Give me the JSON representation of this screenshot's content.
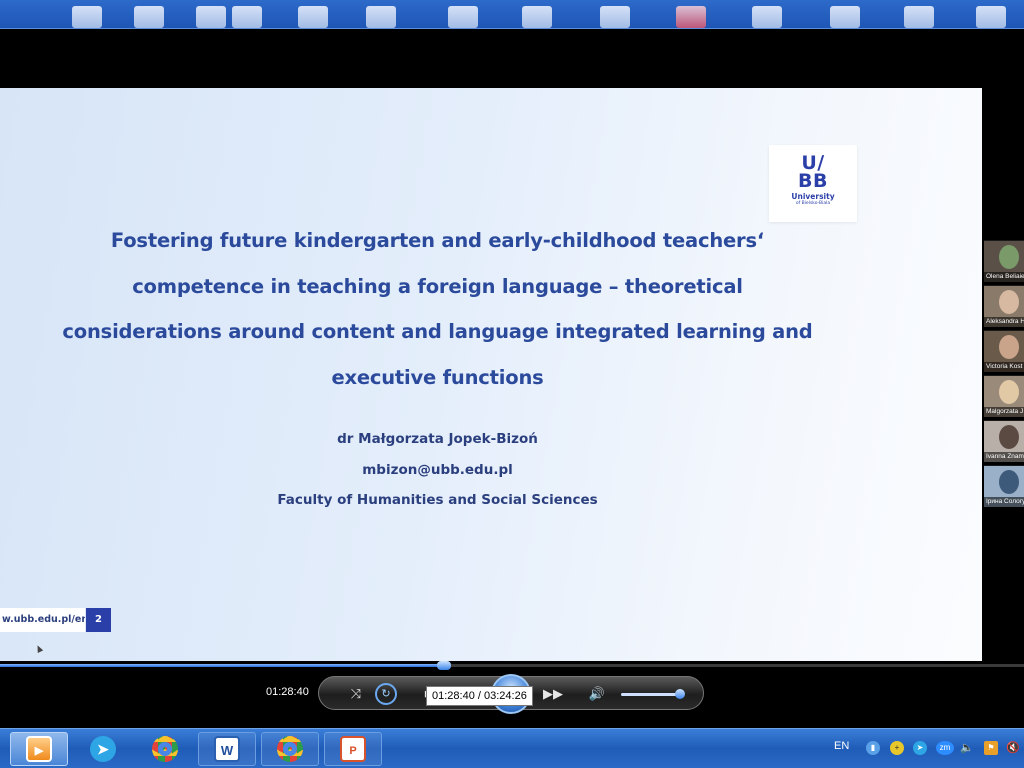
{
  "slide": {
    "title": "Fostering future kindergarten and early-childhood teachers‘ competence in teaching a foreign language – theoretical considerations around content and language integrated learning and executive functions",
    "author": "dr Małgorzata Jopek-Bizoń",
    "email": "mbizon@ubb.edu.pl",
    "faculty": "Faculty of Humanities and Social Sciences",
    "footer_url": "w.ubb.edu.pl/en",
    "page_number": "2",
    "logo": {
      "glyph_top": "U∕",
      "glyph_bottom": "BB",
      "name": "University",
      "sub": "of Bielsko-Biala"
    },
    "accent_color": "#2b3fa8"
  },
  "participants": [
    {
      "name": "Olena Beliaie"
    },
    {
      "name": "Aleksandra H"
    },
    {
      "name": "Victoria Kost"
    },
    {
      "name": "Malgorzata J"
    },
    {
      "name": "Ivanna Znam"
    },
    {
      "name": "Ірина Сологу"
    }
  ],
  "player": {
    "elapsed": "01:28:40",
    "tooltip": "01:28:40 / 03:24:26",
    "progress_fraction": 0.434,
    "volume_fraction": 0.95,
    "icons": [
      "shuffle-icon",
      "repeat-icon",
      "stop-icon",
      "play-icon",
      "next-icon",
      "volume-icon"
    ]
  },
  "taskbar": {
    "language": "EN",
    "apps": [
      "media-player",
      "telegram",
      "chrome",
      "word",
      "chrome-profile",
      "powerpoint"
    ]
  }
}
